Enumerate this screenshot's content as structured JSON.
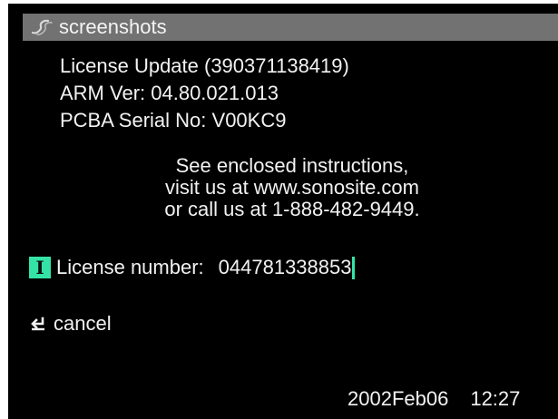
{
  "title_bar": {
    "icon": "sonosite-logo-icon",
    "title": "screenshots"
  },
  "info": {
    "line1": "License Update (390371138419)",
    "line2": "ARM Ver: 04.80.021.013",
    "line3": "PCBA Serial No: V00KC9"
  },
  "instructions": {
    "line1": "See enclosed instructions,",
    "line2": "visit us at www.sonosite.com",
    "line3": "or call us at 1-888-482-9449."
  },
  "license": {
    "badge_icon": "text-input-icon",
    "badge_glyph": "I",
    "label": "License number:",
    "value": "044781338853"
  },
  "cancel": {
    "icon": "return-arrow-icon",
    "label": "cancel"
  },
  "footer": {
    "date": "2002Feb06",
    "time": "12:27"
  },
  "colors": {
    "background": "#000000",
    "title_bar": "#727272",
    "accent": "#34e4a6",
    "text": "#f2f2f2"
  }
}
